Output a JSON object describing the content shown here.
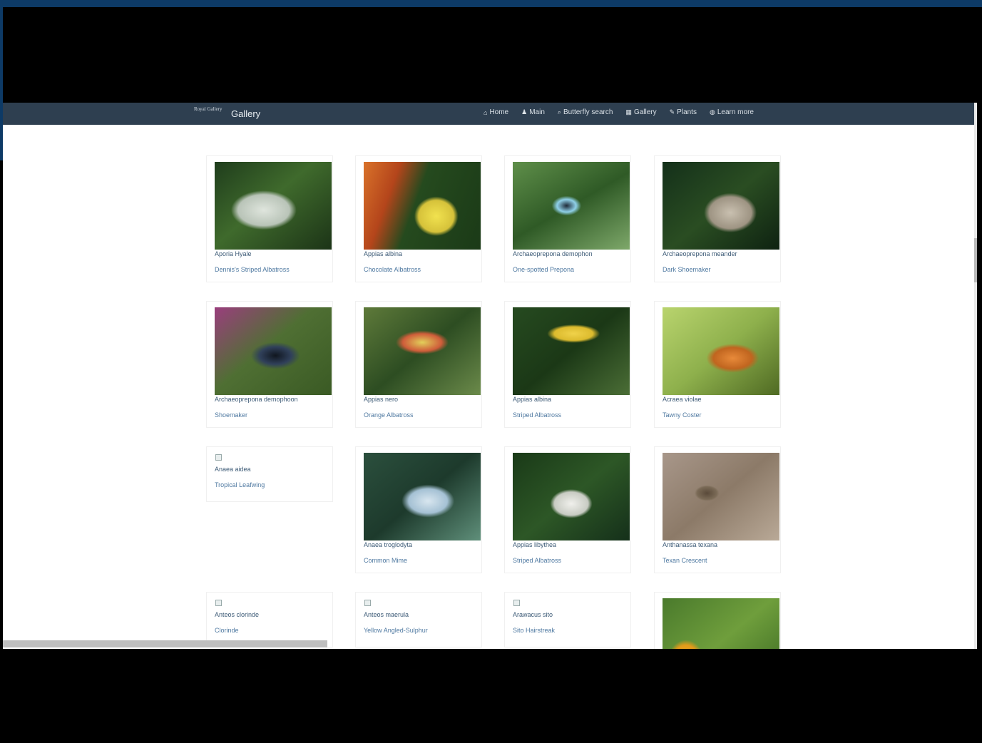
{
  "navbar": {
    "brand_logo": "Royal Gallery",
    "brand_title": "Gallery",
    "links": [
      {
        "icon": "home-icon",
        "glyph": "⌂",
        "label": "Home"
      },
      {
        "icon": "user-icon",
        "glyph": "♟",
        "label": "Main"
      },
      {
        "icon": "search-icon",
        "glyph": "⌕",
        "label": "Butterfly search"
      },
      {
        "icon": "gallery-icon",
        "glyph": "▦",
        "label": "Gallery"
      },
      {
        "icon": "plants-icon",
        "glyph": "✎",
        "label": "Plants"
      },
      {
        "icon": "learn-icon",
        "glyph": "◍",
        "label": "Learn more"
      }
    ]
  },
  "gallery": {
    "cards": [
      {
        "scientific": "Aporia Hyale",
        "common": "Dennis's Striped Albatross",
        "image": "photo"
      },
      {
        "scientific": "Appias albina",
        "common": "Chocolate Albatross",
        "image": "photo"
      },
      {
        "scientific": "Archaeoprepona demophon",
        "common": "One-spotted Prepona",
        "image": "photo"
      },
      {
        "scientific": "Archaeoprepona meander",
        "common": "Dark Shoemaker",
        "image": "photo"
      },
      {
        "scientific": "Archaeoprepona demophoon",
        "common": "Shoemaker",
        "image": "photo"
      },
      {
        "scientific": "Appias nero",
        "common": "Orange Albatross",
        "image": "photo"
      },
      {
        "scientific": "Appias albina",
        "common": "Striped Albatross",
        "image": "photo"
      },
      {
        "scientific": "Acraea violae",
        "common": "Tawny Coster",
        "image": "photo"
      },
      {
        "scientific": "Anaea aidea",
        "common": "Tropical Leafwing",
        "image": "missing"
      },
      {
        "scientific": "Anaea troglodyta",
        "common": "Common Mime",
        "image": "photo"
      },
      {
        "scientific": "Appias libythea",
        "common": "Striped Albatross",
        "image": "photo"
      },
      {
        "scientific": "Anthanassa texana",
        "common": "Texan Crescent",
        "image": "photo"
      },
      {
        "scientific": "Anteos clorinde",
        "common": "Clorinde",
        "image": "missing"
      },
      {
        "scientific": "Anteos maerula",
        "common": "Yellow Angled-Sulphur",
        "image": "missing"
      },
      {
        "scientific": "Arawacus sito",
        "common": "Sito Hairstreak",
        "image": "missing"
      },
      {
        "scientific": "",
        "common": "",
        "image": "photo"
      }
    ]
  },
  "colors": {
    "navbar": "#2e3f50",
    "frame_blue": "#0d3a66",
    "link_text": "#4f79a1"
  }
}
